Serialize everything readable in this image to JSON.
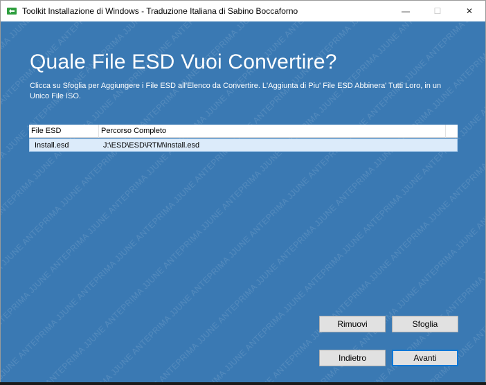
{
  "window": {
    "title": "Toolkit Installazione di Windows - Traduzione Italiana di Sabino Boccaforno",
    "icon": "toolkit-app-icon",
    "controls": {
      "minimize": "—",
      "maximize": "☐",
      "close": "✕"
    }
  },
  "watermark": {
    "text": "JUNE ANTEPRIMA"
  },
  "page": {
    "heading": "Quale File ESD Vuoi Convertire?",
    "description": "Clicca su Sfoglia per Aggiungere i File ESD all'Elenco da Convertire. L'Aggiunta di Piu' File ESD Abbinera' Tutti Loro, in un Unico File ISO."
  },
  "file_list": {
    "columns": [
      "File ESD",
      "Percorso Completo"
    ],
    "rows": [
      {
        "name": "Install.esd",
        "path": "J:\\ESD\\ESD\\RTM\\Install.esd",
        "selected": true
      }
    ]
  },
  "buttons": {
    "remove": "Rimuovi",
    "browse": "Sfoglia",
    "back": "Indietro",
    "next": "Avanti"
  },
  "colors": {
    "background": "#3a79b3",
    "selected_row": "#dcebfa",
    "accent": "#0078d7"
  }
}
